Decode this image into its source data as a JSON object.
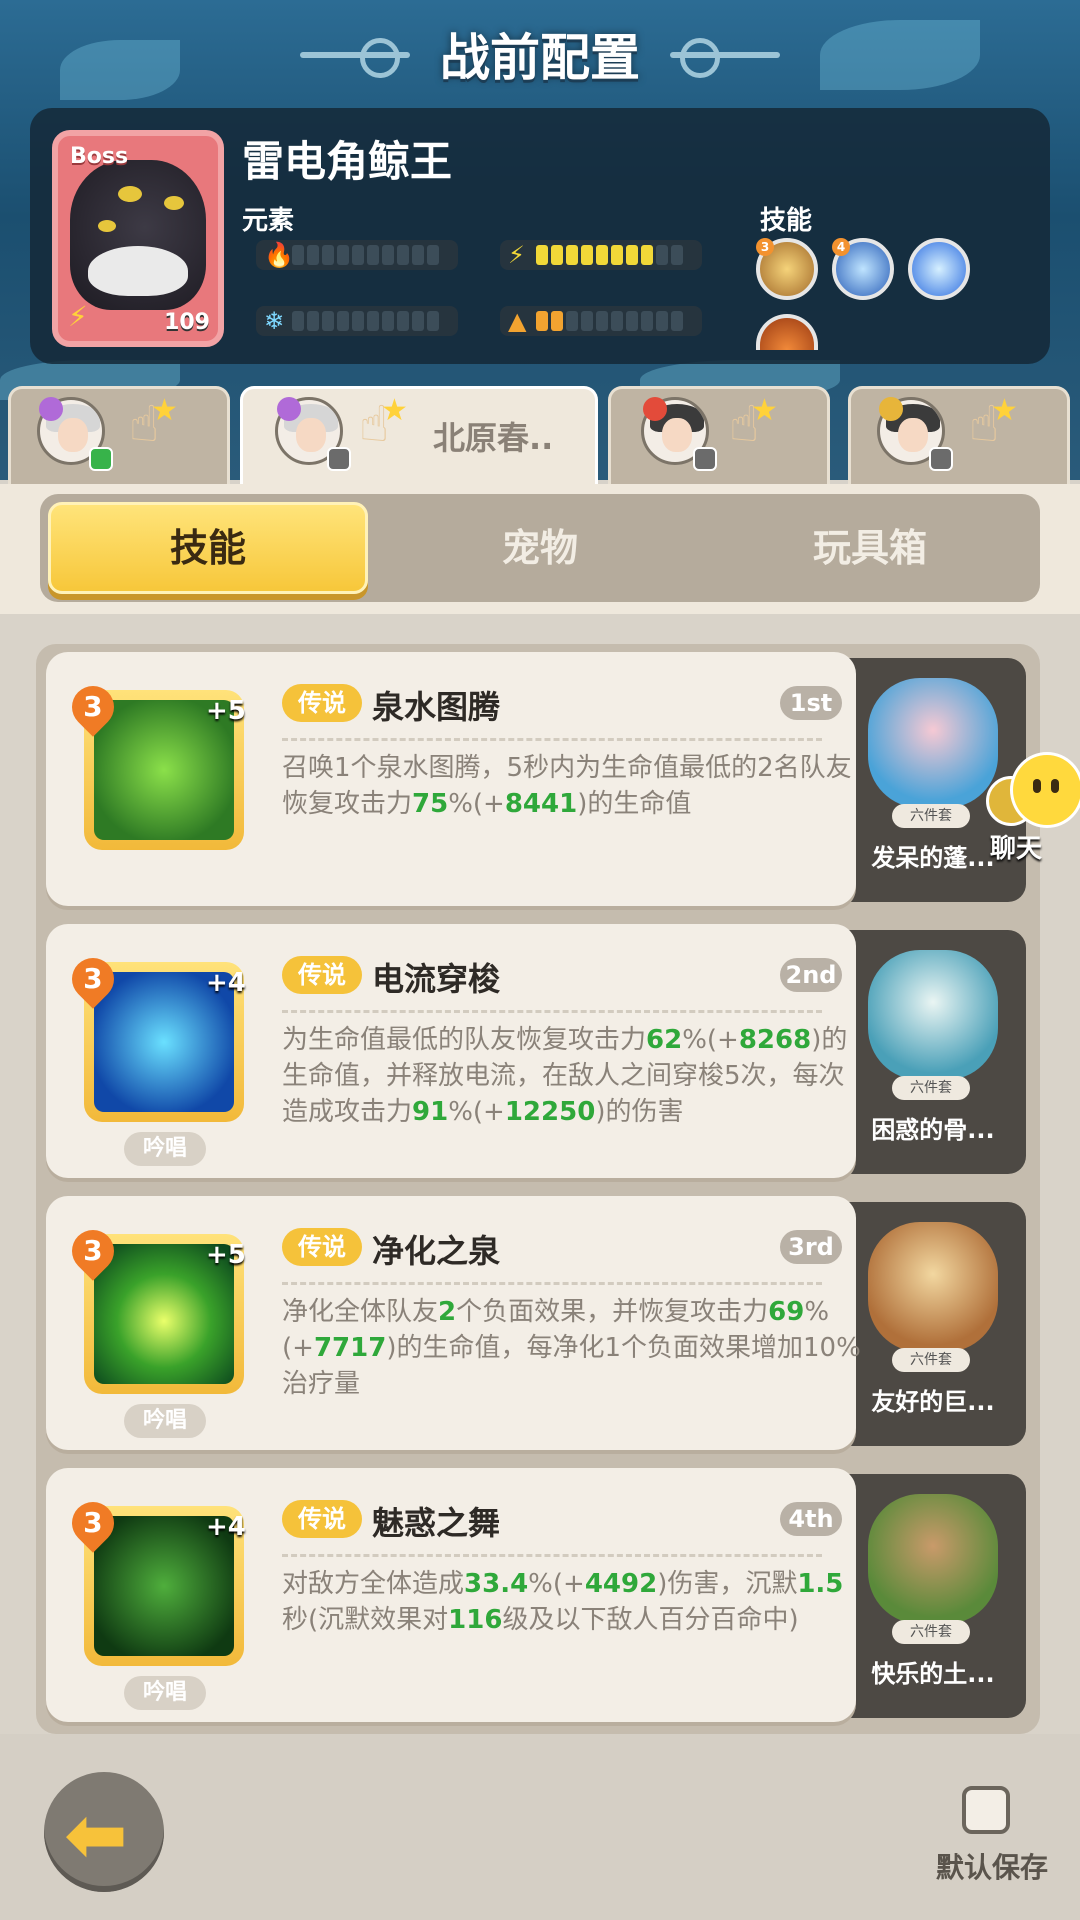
{
  "header": {
    "title": "战前配置"
  },
  "boss": {
    "tag": "Boss",
    "level": "109",
    "name": "雷电角鲸王",
    "element_label": "元素",
    "skill_label": "技能",
    "elements": [
      {
        "icon": "fire-icon",
        "level": 0,
        "max": 10
      },
      {
        "icon": "lightning-icon",
        "level": 8,
        "max": 10
      },
      {
        "icon": "ice-icon",
        "level": 0,
        "max": 10
      },
      {
        "icon": "earth-icon",
        "level": 2,
        "max": 10
      }
    ],
    "skills": [
      {
        "icon": "beast-skill-icon",
        "badge": "3"
      },
      {
        "icon": "thunder-claw-icon",
        "badge": "4"
      },
      {
        "icon": "lightning-orb-icon",
        "badge": ""
      }
    ]
  },
  "hero_tabs": [
    {
      "name": "",
      "badge": "green"
    },
    {
      "name": "北原春..",
      "badge": "grey"
    },
    {
      "name": "",
      "badge": "grey"
    },
    {
      "name": "",
      "badge": "grey"
    }
  ],
  "category_tabs": [
    "技能",
    "宠物",
    "玩具箱"
  ],
  "chat": {
    "label": "聊天"
  },
  "skills": [
    {
      "level": "3",
      "plus": "+5",
      "rarity": "传说",
      "name": "泉水图腾",
      "rank": "1st",
      "chant": "",
      "desc": [
        "召唤1个泉水图腾，5秒内为生命值最低的2名队友恢复攻击力",
        "75",
        "%(+",
        "8441",
        ")的生命值"
      ],
      "pet": {
        "set": "六件套",
        "name": "发呆的蓬..."
      }
    },
    {
      "level": "3",
      "plus": "+4",
      "rarity": "传说",
      "name": "电流穿梭",
      "rank": "2nd",
      "chant": "吟唱",
      "desc": [
        "为生命值最低的队友恢复攻击力",
        "62",
        "%(+",
        "8268",
        ")的生命值，并释放电流，在敌人之间穿梭5次，每次造成攻击力",
        "91",
        "%(+",
        "12250",
        ")的伤害"
      ],
      "pet": {
        "set": "六件套",
        "name": "困惑的骨..."
      }
    },
    {
      "level": "3",
      "plus": "+5",
      "rarity": "传说",
      "name": "净化之泉",
      "rank": "3rd",
      "chant": "吟唱",
      "desc": [
        "净化全体队友",
        "2",
        "个负面效果，并恢复攻击力",
        "69",
        "%(+",
        "7717",
        ")的生命值，每净化1个负面效果增加10%治疗量"
      ],
      "pet": {
        "set": "六件套",
        "name": "友好的巨..."
      }
    },
    {
      "level": "3",
      "plus": "+4",
      "rarity": "传说",
      "name": "魅惑之舞",
      "rank": "4th",
      "chant": "吟唱",
      "desc": [
        "对敌方全体造成",
        "33.4",
        "%(+",
        "4492",
        ")伤害，沉默",
        "1.5",
        "秒(沉默效果对",
        "116",
        "级及以下敌人百分百命中)"
      ],
      "pet": {
        "set": "六件套",
        "name": "快乐的土..."
      }
    }
  ],
  "bottom": {
    "save_label": "默认保存"
  }
}
